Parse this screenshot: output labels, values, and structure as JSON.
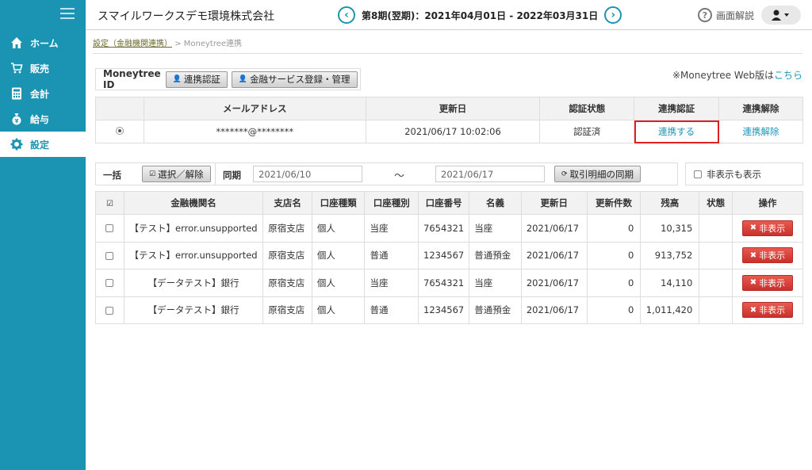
{
  "sidebar": {
    "items": [
      {
        "label": "ホーム",
        "icon": "home-icon"
      },
      {
        "label": "販売",
        "icon": "cart-icon"
      },
      {
        "label": "会計",
        "icon": "calculator-icon"
      },
      {
        "label": "給与",
        "icon": "money-bag-icon"
      },
      {
        "label": "設定",
        "icon": "gear-icon",
        "active": true
      }
    ]
  },
  "header": {
    "company": "スマイルワークスデモ環境株式会社",
    "period": "第8期(翌期)：2021年04月01日 - 2022年03月31日",
    "help_label": "画面解説"
  },
  "breadcrumb": {
    "parent": "設定（金融機関連携）",
    "separator": ">",
    "current": "Moneytree連携"
  },
  "moneytree": {
    "id_label": "Moneytree ID",
    "auth_button": "連携認証",
    "manage_button": "金融サービス登録・管理",
    "web_note_prefix": "※Moneytree Web版は",
    "web_note_link": "こちら"
  },
  "account_table": {
    "headers": [
      "",
      "メールアドレス",
      "更新日",
      "認証状態",
      "連携認証",
      "連携解除"
    ],
    "row": {
      "email": "*******@********",
      "updated": "2021/06/17 10:02:06",
      "status": "認証済",
      "link_action": "連携する",
      "unlink_action": "連携解除"
    }
  },
  "filter": {
    "bulk_label": "一括",
    "toggle_button": "選択／解除",
    "period_label": "同期",
    "date_from": "2021/06/10",
    "tilde": "～",
    "date_to": "2021/06/17",
    "sync_button": "取引明細の同期",
    "show_hidden": "非表示も表示"
  },
  "data_table": {
    "headers": [
      "",
      "金融機関名",
      "支店名",
      "口座種類",
      "口座種別",
      "口座番号",
      "名義",
      "更新日",
      "更新件数",
      "残高",
      "状態",
      "操作"
    ],
    "hide_label": "非表示",
    "rows": [
      {
        "bank": "【テスト】error.unsupported",
        "branch": "原宿支店",
        "kind": "個人",
        "type": "当座",
        "number": "7654321",
        "holder": "当座",
        "date": "2021/06/17",
        "count": "0",
        "balance": "10,315",
        "state": ""
      },
      {
        "bank": "【テスト】error.unsupported",
        "branch": "原宿支店",
        "kind": "個人",
        "type": "普通",
        "number": "1234567",
        "holder": "普通預金",
        "date": "2021/06/17",
        "count": "0",
        "balance": "913,752",
        "state": ""
      },
      {
        "bank": "【データテスト】銀行",
        "branch": "原宿支店",
        "kind": "個人",
        "type": "当座",
        "number": "7654321",
        "holder": "当座",
        "date": "2021/06/17",
        "count": "0",
        "balance": "14,110",
        "state": ""
      },
      {
        "bank": "【データテスト】銀行",
        "branch": "原宿支店",
        "kind": "個人",
        "type": "普通",
        "number": "1234567",
        "holder": "普通預金",
        "date": "2021/06/17",
        "count": "0",
        "balance": "1,011,420",
        "state": ""
      }
    ]
  },
  "colors": {
    "accent": "#1b94b4",
    "danger": "#d9534f",
    "highlight": "#e02020"
  }
}
